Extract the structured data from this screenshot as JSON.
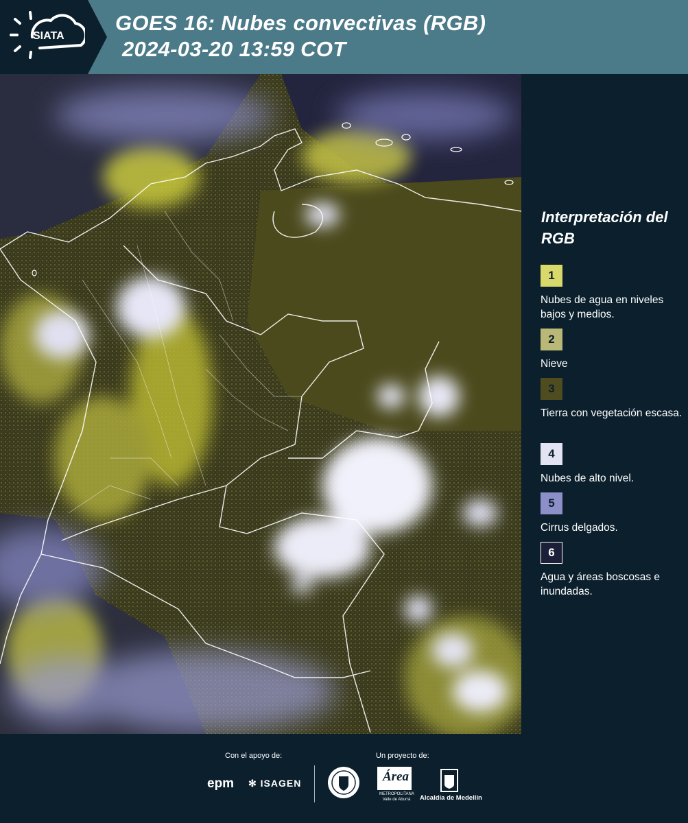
{
  "header": {
    "logo_text": "SIATA",
    "title_line1": "GOES 16: Nubes convectivas (RGB)",
    "title_line2": "2024-03-20 13:59 COT"
  },
  "colors": {
    "header_bg": "#4b7a88",
    "dark_bg": "#0b1f2c",
    "map_base": "#39391c",
    "low_cloud_yellow": "#d4d43c",
    "high_cloud_white": "#e8e8f6",
    "cirrus_lavender": "#8a8cc8"
  },
  "legend": {
    "title": "Interpretación del RGB",
    "items": [
      {
        "number": "1",
        "label": "Nubes de agua en niveles bajos y medios.",
        "color": "#d9d86a"
      },
      {
        "number": "2",
        "label": "Nieve",
        "color": "#b9b877"
      },
      {
        "number": "3",
        "label": "Tierra con vegetación escasa.",
        "color": "#4f4d1f"
      },
      {
        "number": "4",
        "label": "Nubes de alto nivel.",
        "color": "#e3e3f4"
      },
      {
        "number": "5",
        "label": "Cirrus delgados.",
        "color": "#8d8fc9"
      },
      {
        "number": "6",
        "label": "Agua y áreas boscosas e inundadas.",
        "color": "#1c1f38"
      }
    ]
  },
  "footer": {
    "support_label": "Con el apoyo de:",
    "project_label": "Un proyecto de:",
    "epm_logo": "epm",
    "isagen_logo": "ISAGEN",
    "area_logo_word": "Área",
    "area_logo_sub": "METROPOLITANA Valle de Aburrá",
    "alcaldia_label": "Alcaldía de Medellín"
  }
}
